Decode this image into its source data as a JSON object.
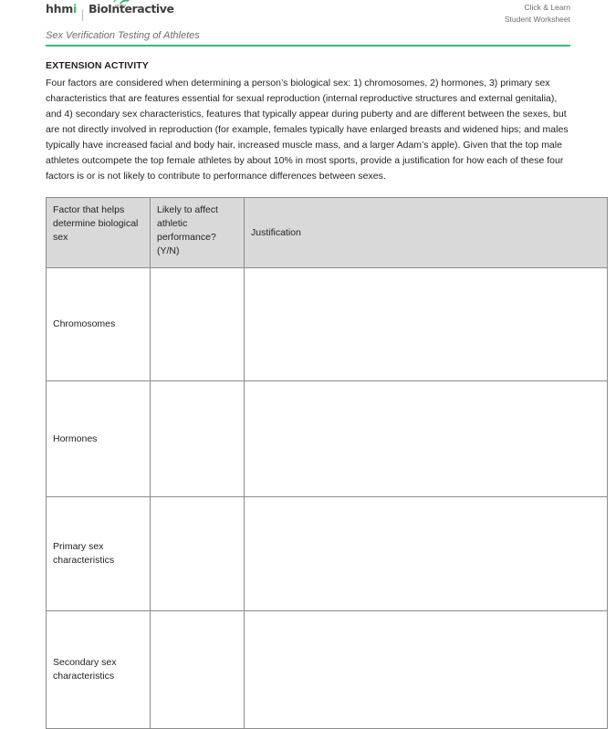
{
  "masthead": {
    "logo": {
      "hhmi_prefix": "hhm",
      "hhmi_accent_letter": "i",
      "brand": "BioInteractive",
      "mark_icon": "hhmi-leaf-mark-icon"
    },
    "right_line_1": "Click & Learn",
    "right_line_2": "Student Worksheet"
  },
  "title_strip": {
    "doc_title": "Sex Verification Testing of Athletes",
    "rule_color": "#3cb878"
  },
  "content": {
    "section_heading": "EXTENSION ACTIVITY",
    "intro_paragraph": "Four factors are considered when determining a person’s biological sex: 1) chromosomes, 2) hormones, 3) primary sex characteristics that are features essential for sexual reproduction (internal reproductive structures and external genitalia), and 4) secondary sex characteristics, features that typically appear during puberty and are different between the sexes, but are not directly involved in reproduction (for example, females typically have enlarged breasts and widened hips; and males typically have increased facial and body hair, increased muscle mass, and a larger Adam’s apple). Given that the top male athletes outcompete the top female athletes by about 10% in most sports, provide a justification for how each of these four factors is or is not likely to contribute to performance differences between sexes."
  },
  "worksheet_table": {
    "header_background": "#d9d9d9",
    "columns": [
      "Factor that helps determine biological sex",
      "Likely to affect athletic performance? (Y/N)",
      "Justification"
    ],
    "rows": [
      {
        "factor": "Chromosomes",
        "likely": "",
        "justification": ""
      },
      {
        "factor": "Hormones",
        "likely": "",
        "justification": ""
      },
      {
        "factor": "Primary sex characteristics",
        "likely": "",
        "justification": ""
      },
      {
        "factor": "Secondary sex characteristics",
        "likely": "",
        "justification": ""
      }
    ]
  }
}
